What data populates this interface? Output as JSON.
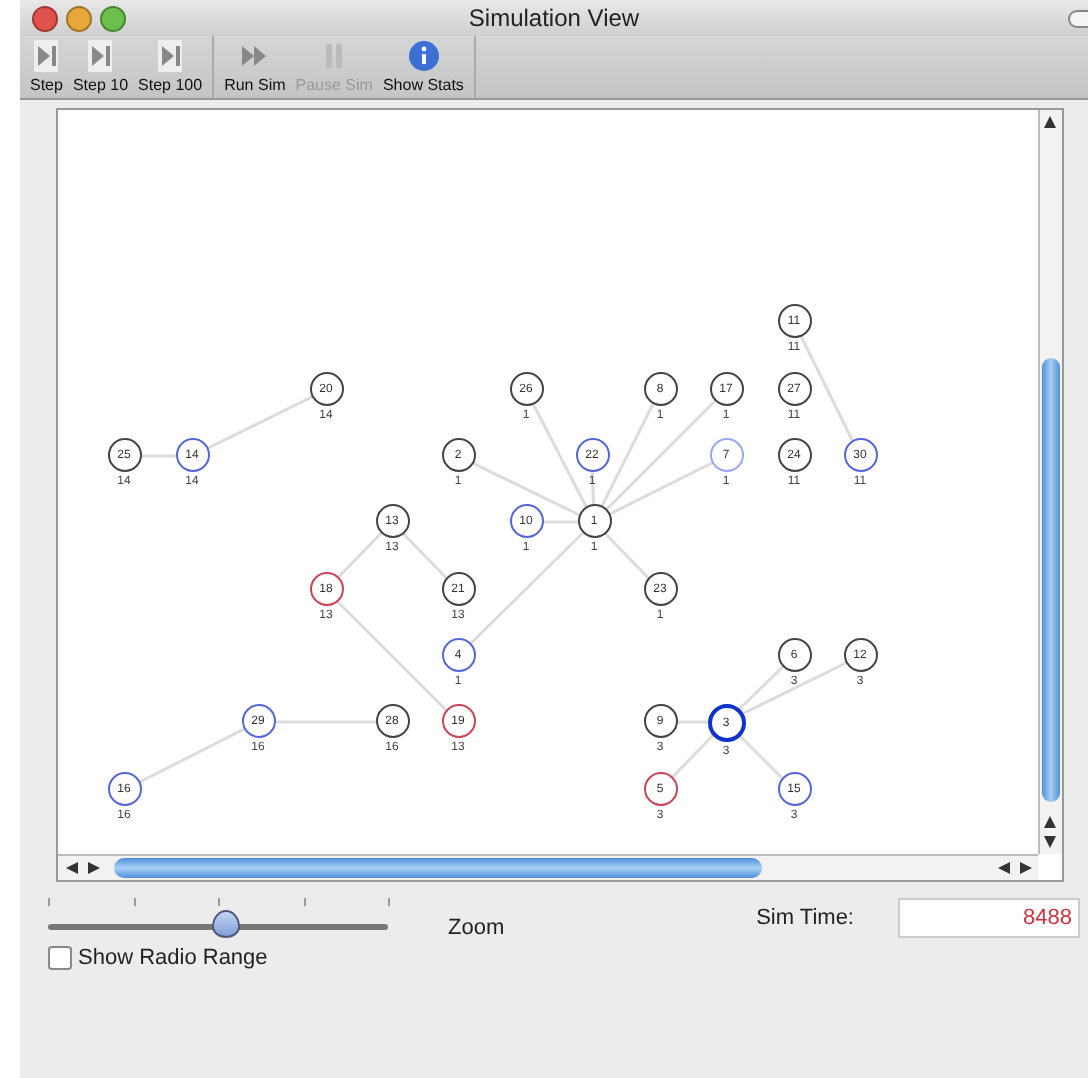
{
  "window": {
    "title": "Simulation View"
  },
  "toolbar": [
    {
      "label": "Step",
      "kind": "step",
      "disabled": false
    },
    {
      "label": "Step 10",
      "kind": "step",
      "disabled": false
    },
    {
      "label": "Step 100",
      "kind": "step",
      "disabled": false
    },
    {
      "label": "Run Sim",
      "kind": "run",
      "disabled": false
    },
    {
      "label": "Pause Sim",
      "kind": "pause",
      "disabled": true
    },
    {
      "label": "Show Stats",
      "kind": "info",
      "disabled": false
    }
  ],
  "network": [
    {
      "id": "14",
      "group": "14",
      "color": "#5566dd",
      "children": [
        {
          "id": "25",
          "group": "14",
          "color": "#444444"
        },
        {
          "id": "20",
          "group": "14",
          "color": "#444444"
        }
      ]
    },
    {
      "id": "1",
      "group": "1",
      "color": "#444444",
      "children": [
        {
          "id": "2",
          "group": "1",
          "color": "#444444"
        },
        {
          "id": "26",
          "group": "1",
          "color": "#444444"
        },
        {
          "id": "22",
          "group": "1",
          "color": "#5566dd"
        },
        {
          "id": "10",
          "group": "1",
          "color": "#5566dd"
        },
        {
          "id": "8",
          "group": "1",
          "color": "#444444"
        },
        {
          "id": "17",
          "group": "1",
          "color": "#444444"
        },
        {
          "id": "7",
          "group": "1",
          "color": "#9aa6ee"
        },
        {
          "id": "23",
          "group": "1",
          "color": "#444444"
        },
        {
          "id": "4",
          "group": "1",
          "color": "#5566dd"
        }
      ]
    },
    {
      "id": "13",
      "group": "13",
      "color": "#444444",
      "children": [
        {
          "id": "18",
          "group": "13",
          "color": "#cc4455",
          "children": [
            {
              "id": "19",
              "group": "13",
              "color": "#cc4455"
            }
          ]
        },
        {
          "id": "21",
          "group": "13",
          "color": "#444444"
        }
      ]
    },
    {
      "id": "29",
      "group": "16",
      "color": "#5566dd",
      "children": [
        {
          "id": "28",
          "group": "16",
          "color": "#444444"
        },
        {
          "id": "16",
          "group": "16",
          "color": "#5566dd"
        }
      ]
    },
    {
      "id": "11",
      "group": "11",
      "color": "#444444",
      "children": [
        {
          "id": "30",
          "group": "11",
          "color": "#5566dd"
        }
      ]
    },
    {
      "id": "27",
      "group": "11",
      "color": "#444444"
    },
    {
      "id": "24",
      "group": "11",
      "color": "#444444"
    },
    {
      "id": "3",
      "group": "3",
      "color": "#1133cc",
      "children": [
        {
          "id": "9",
          "group": "3",
          "color": "#444444"
        },
        {
          "id": "6",
          "group": "3",
          "color": "#444444"
        },
        {
          "id": "12",
          "group": "3",
          "color": "#444444"
        },
        {
          "id": "5",
          "group": "3",
          "color": "#cc4455"
        },
        {
          "id": "15",
          "group": "3",
          "color": "#5566dd"
        }
      ]
    }
  ],
  "zoom": {
    "label": "Zoom",
    "level": 0.52
  },
  "radio_range": {
    "label": "Show Radio Range",
    "checked": false
  },
  "sim_time": {
    "label": "Sim Time:",
    "value": "8488"
  }
}
